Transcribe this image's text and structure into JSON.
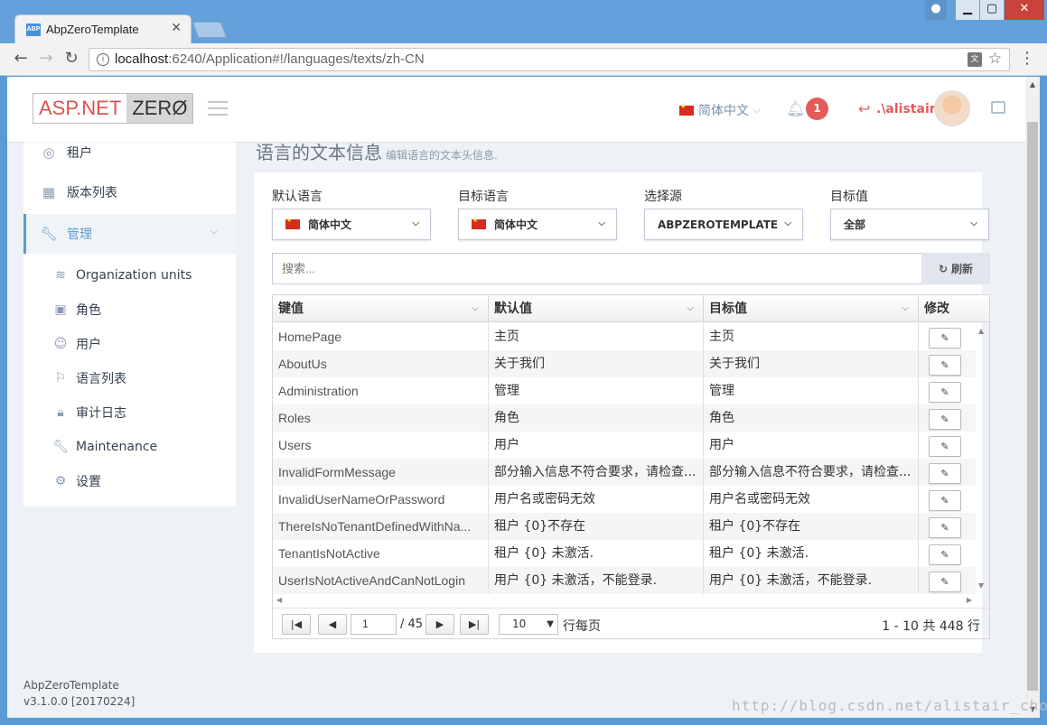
{
  "browser": {
    "tab_title": "AbpZeroTemplate",
    "tab_favicon": "ABP",
    "url_host": "localhost",
    "url_rest": ":6240/Application#!/languages/texts/zh-CN"
  },
  "header": {
    "logo_left": "ASP.NET",
    "logo_right": "ZERØ",
    "language": "简体中文",
    "notification_count": "1",
    "username": ".\\alistair"
  },
  "sidebar": {
    "items": [
      {
        "label": "租户",
        "icon": "globe-icon"
      },
      {
        "label": "版本列表",
        "icon": "grid-icon"
      },
      {
        "label": "管理",
        "icon": "wrench-icon"
      }
    ],
    "sub_items": [
      {
        "label": "Organization units",
        "icon": "layers-icon"
      },
      {
        "label": "角色",
        "icon": "briefcase-icon"
      },
      {
        "label": "用户",
        "icon": "user-icon"
      },
      {
        "label": "语言列表",
        "icon": "flag-icon"
      },
      {
        "label": "审计日志",
        "icon": "lock-icon"
      },
      {
        "label": "Maintenance",
        "icon": "wrench-icon"
      },
      {
        "label": "设置",
        "icon": "gear-icon"
      }
    ]
  },
  "footer": {
    "app_name": "AbpZeroTemplate",
    "version": "v3.1.0.0 [20170224]"
  },
  "page": {
    "title": "语言的文本信息",
    "subtitle": "编辑语言的文本头信息."
  },
  "filters": {
    "default_language_label": "默认语言",
    "default_language_value": "简体中文",
    "target_language_label": "目标语言",
    "target_language_value": "简体中文",
    "source_label": "选择源",
    "source_value": "ABPZEROTEMPLATE",
    "target_value_label": "目标值",
    "target_value_value": "全部",
    "search_placeholder": "搜索...",
    "refresh_label": "刷新"
  },
  "grid": {
    "columns": [
      "键值",
      "默认值",
      "目标值",
      "修改"
    ],
    "rows": [
      {
        "key": "HomePage",
        "default": "主页",
        "target": "主页"
      },
      {
        "key": "AboutUs",
        "default": "关于我们",
        "target": "关于我们"
      },
      {
        "key": "Administration",
        "default": "管理",
        "target": "管理"
      },
      {
        "key": "Roles",
        "default": "角色",
        "target": "角色"
      },
      {
        "key": "Users",
        "default": "用户",
        "target": "用户"
      },
      {
        "key": "InvalidFormMessage",
        "default": "部分输入信息不符合要求，请检查...",
        "target": "部分输入信息不符合要求，请检查..."
      },
      {
        "key": "InvalidUserNameOrPassword",
        "default": "用户名或密码无效",
        "target": "用户名或密码无效"
      },
      {
        "key": "ThereIsNoTenantDefinedWithNa...",
        "default": "租户 {0}不存在",
        "target": "租户 {0}不存在"
      },
      {
        "key": "TenantIsNotActive",
        "default": "租户 {0} 未激活.",
        "target": "租户 {0} 未激活."
      },
      {
        "key": "UserIsNotActiveAndCanNotLogin",
        "default": "用户 {0} 未激活，不能登录.",
        "target": "用户 {0} 未激活，不能登录."
      }
    ]
  },
  "pager": {
    "current_page": "1",
    "total_pages": "/ 45",
    "page_size": "10",
    "page_size_label": "行每页",
    "info": "1 - 10 共 448 行"
  },
  "watermark": "http://blog.csdn.net/alistair_chow"
}
